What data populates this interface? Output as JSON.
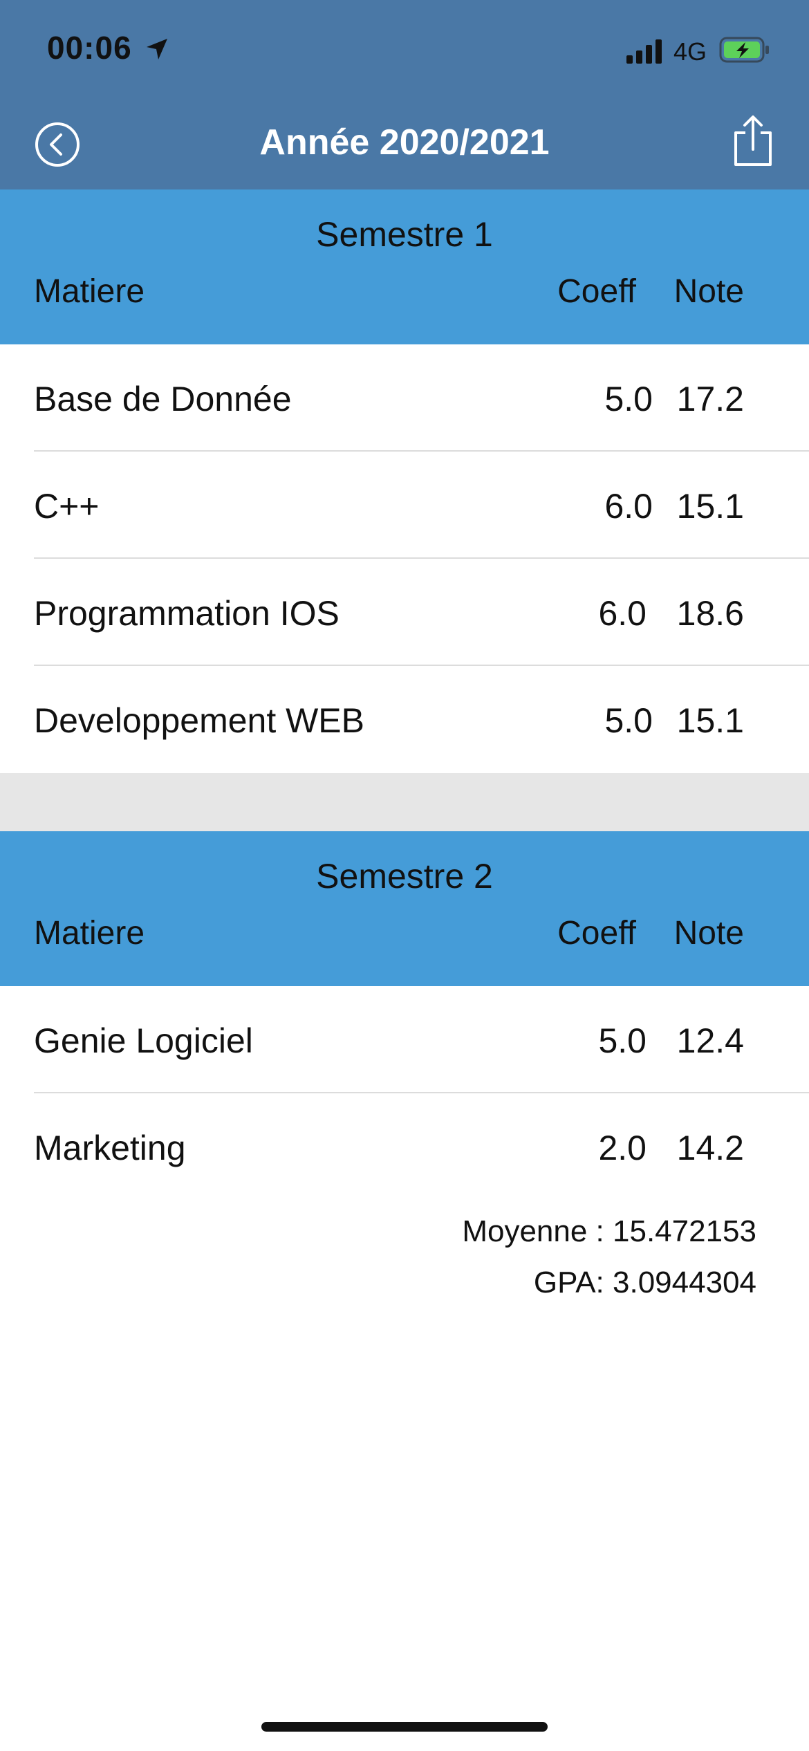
{
  "status_bar": {
    "time": "00:06",
    "network": "4G",
    "icons": [
      "location-arrow-icon",
      "signal-bars-icon",
      "battery-charging-icon"
    ]
  },
  "nav": {
    "title": "Année 2020/2021",
    "back_icon": "chevron-left-circle-icon",
    "share_icon": "share-icon"
  },
  "colors": {
    "nav_bar": "#4a78a6",
    "section_header": "#459cd8",
    "section_gap": "#e6e6e6"
  },
  "semesters": [
    {
      "title": "Semestre 1",
      "columns": {
        "subject": "Matiere",
        "coeff": "Coeff",
        "note": "Note"
      },
      "rows": [
        {
          "subject": "Base de Donnée",
          "coeff": "5.0",
          "note": "17.2"
        },
        {
          "subject": "C++",
          "coeff": "6.0",
          "note": "15.1"
        },
        {
          "subject": "Programmation IOS",
          "coeff": "6.0",
          "note": "18.6"
        },
        {
          "subject": "Developpement WEB",
          "coeff": "5.0",
          "note": "15.1"
        }
      ]
    },
    {
      "title": "Semestre 2",
      "columns": {
        "subject": "Matiere",
        "coeff": "Coeff",
        "note": "Note"
      },
      "rows": [
        {
          "subject": "Genie Logiciel",
          "coeff": "5.0",
          "note": "12.4"
        },
        {
          "subject": "Marketing",
          "coeff": "2.0",
          "note": "14.2"
        }
      ]
    }
  ],
  "summary": {
    "average": "Moyenne : 15.472153",
    "gpa": "GPA: 3.0944304"
  }
}
